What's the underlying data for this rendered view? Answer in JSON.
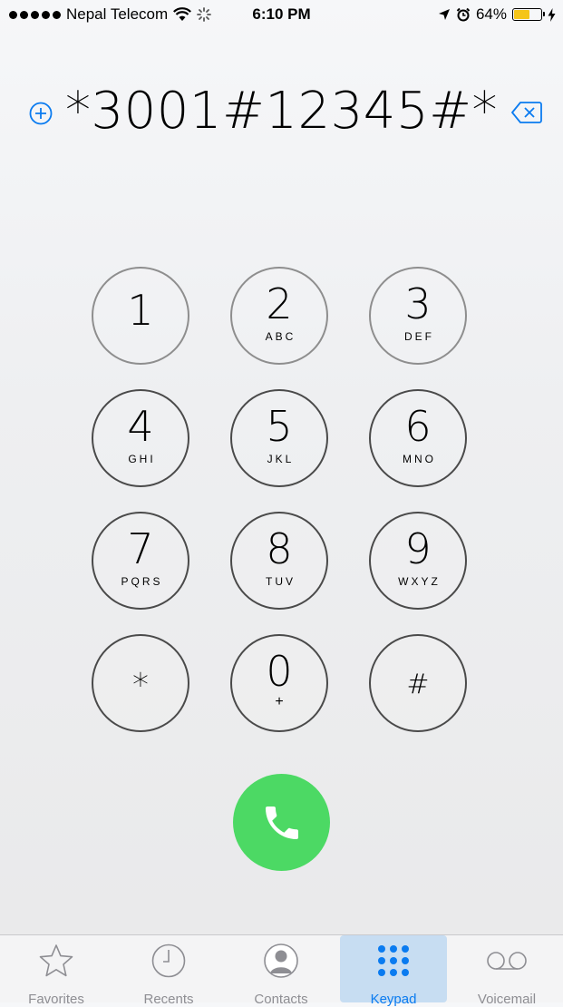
{
  "status_bar": {
    "carrier": "Nepal Telecom",
    "time": "6:10 PM",
    "battery_percent": "64%",
    "battery_level": 0.64,
    "colors": {
      "battery_fill": "#f5c518"
    }
  },
  "dialer": {
    "number": "*3001#12345#*",
    "add_icon": "plus-circle-icon",
    "delete_icon": "delete-backspace-icon",
    "accent": "#0a7bf0"
  },
  "keys": [
    {
      "digit": "1",
      "letters": ""
    },
    {
      "digit": "2",
      "letters": "ABC"
    },
    {
      "digit": "3",
      "letters": "DEF"
    },
    {
      "digit": "4",
      "letters": "GHI"
    },
    {
      "digit": "5",
      "letters": "JKL"
    },
    {
      "digit": "6",
      "letters": "MNO"
    },
    {
      "digit": "7",
      "letters": "PQRS"
    },
    {
      "digit": "8",
      "letters": "TUV"
    },
    {
      "digit": "9",
      "letters": "WXYZ"
    },
    {
      "digit": "*",
      "letters": ""
    },
    {
      "digit": "0",
      "letters": "+"
    },
    {
      "digit": "#",
      "letters": ""
    }
  ],
  "call_button": {
    "icon": "phone-icon",
    "color": "#4cd964"
  },
  "tabs": [
    {
      "label": "Favorites",
      "icon": "star-icon",
      "active": false
    },
    {
      "label": "Recents",
      "icon": "clock-icon",
      "active": false
    },
    {
      "label": "Contacts",
      "icon": "person-icon",
      "active": false
    },
    {
      "label": "Keypad",
      "icon": "keypad-icon",
      "active": true
    },
    {
      "label": "Voicemail",
      "icon": "voicemail-icon",
      "active": false
    }
  ]
}
